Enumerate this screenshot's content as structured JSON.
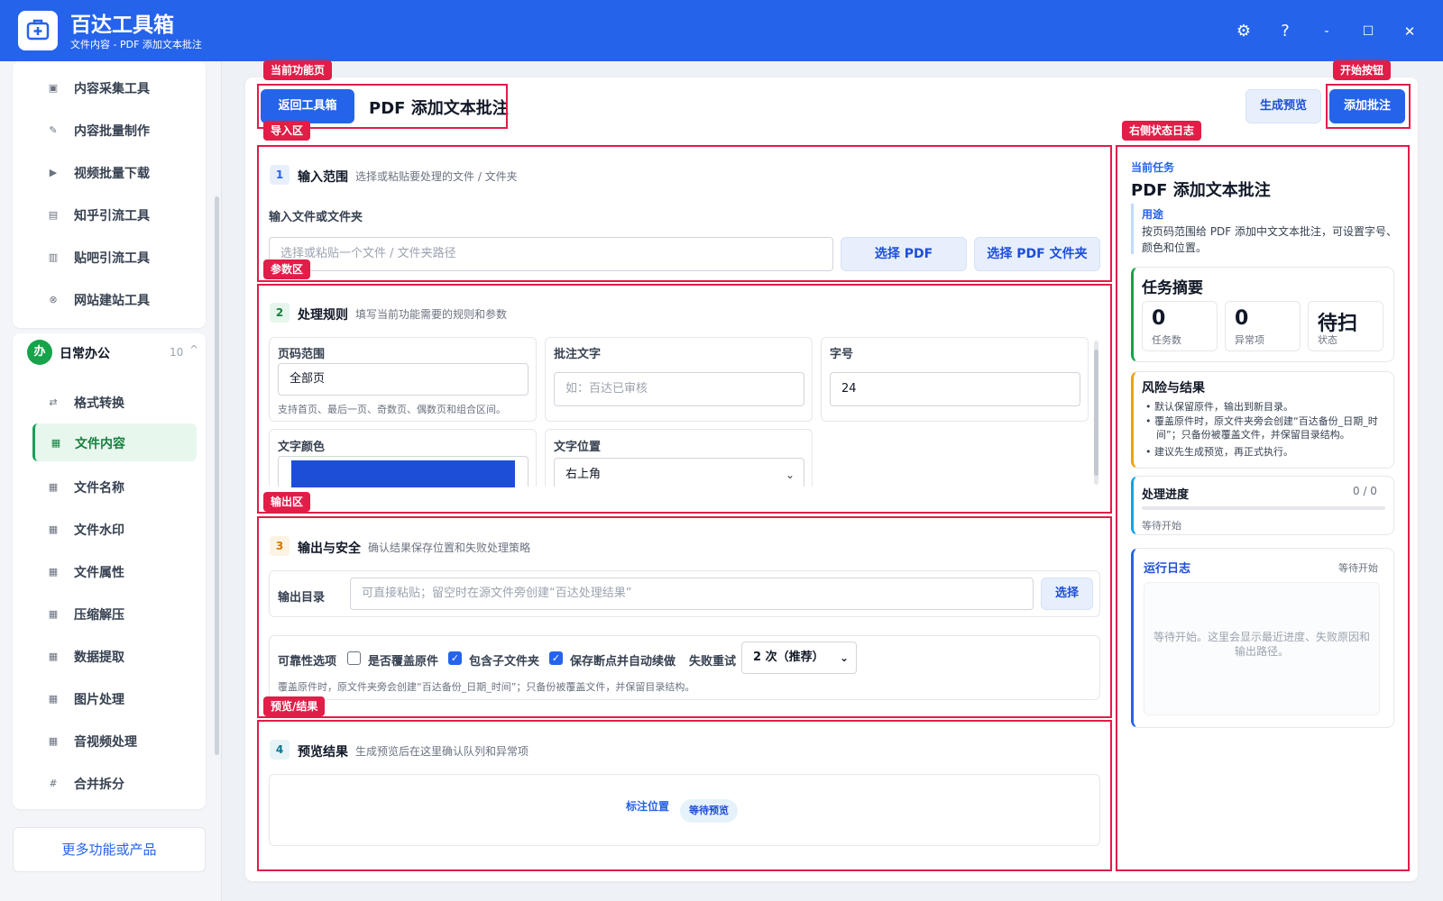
{
  "app": {
    "title": "百达工具箱",
    "subtitle": "文件内容 - PDF 添加文本批注",
    "window_controls": [
      "gear-icon",
      "help-icon",
      "minimize-icon",
      "maximize-icon",
      "close-icon"
    ],
    "window_glyphs": {
      "settings": "⚙",
      "help": "?",
      "minimize": "-",
      "maximize": "☐",
      "close": "✕"
    }
  },
  "sidebar": {
    "top_items": [
      {
        "label": "内容采集工具",
        "icon": "collect-icon"
      },
      {
        "label": "内容批量制作",
        "icon": "edit-icon"
      },
      {
        "label": "视频批量下载",
        "icon": "video-icon"
      },
      {
        "label": "知乎引流工具",
        "icon": "zhihu-icon"
      },
      {
        "label": "贴吧引流工具",
        "icon": "tieba-icon"
      },
      {
        "label": "网站建站工具",
        "icon": "website-icon"
      }
    ],
    "group": {
      "icon_text": "办",
      "label": "日常办公",
      "count": "10",
      "caret": "^"
    },
    "group_items": [
      {
        "label": "格式转换",
        "icon": "convert-icon"
      },
      {
        "label": "文件内容",
        "icon": "grid-icon"
      },
      {
        "label": "文件名称",
        "icon": "grid-icon"
      },
      {
        "label": "文件水印",
        "icon": "grid-icon"
      },
      {
        "label": "文件属性",
        "icon": "grid-icon"
      },
      {
        "label": "压缩解压",
        "icon": "grid-icon"
      },
      {
        "label": "数据提取",
        "icon": "grid-icon"
      },
      {
        "label": "图片处理",
        "icon": "grid-icon"
      },
      {
        "label": "音视频处理",
        "icon": "grid-icon"
      },
      {
        "label": "合并拆分",
        "icon": "hash-icon"
      }
    ],
    "active_item": "文件内容",
    "more_button": "更多功能或产品"
  },
  "tags": {
    "current_page": "当前功能页",
    "start_button": "开始按钮",
    "import_area": "导入区",
    "right_log": "右侧状态日志",
    "params_area": "参数区",
    "output_area": "输出区",
    "preview_result": "预览/结果"
  },
  "header": {
    "back_button": "返回工具箱",
    "page_title": "PDF 添加文本批注",
    "preview_button": "生成预览",
    "start_button": "添加批注"
  },
  "section1": {
    "num": "1",
    "title": "输入范围",
    "desc": "选择或粘贴要处理的文件 / 文件夹",
    "field_label": "输入文件或文件夹",
    "input_placeholder": "选择或粘贴一个文件 / 文件夹路径",
    "btn_pdf": "选择 PDF",
    "btn_folder": "选择 PDF 文件夹"
  },
  "section2": {
    "num": "2",
    "title": "处理规则",
    "desc": "填写当前功能需要的规则和参数",
    "page_range": {
      "label": "页码范围",
      "value": "全部页",
      "hint": "支持首页、最后一页、奇数页、偶数页和组合区间。"
    },
    "note_text": {
      "label": "批注文字",
      "placeholder": "如：百达已审核"
    },
    "font_size": {
      "label": "字号",
      "value": "24"
    },
    "text_color": {
      "label": "文字颜色",
      "value": "#1d4ed8"
    },
    "text_position": {
      "label": "文字位置",
      "value": "右上角"
    }
  },
  "section3": {
    "num": "3",
    "title": "输出与安全",
    "desc": "确认结果保存位置和失败处理策略",
    "output_label": "输出目录",
    "output_placeholder": "可直接粘贴；留空时在源文件旁创建“百达处理结果”",
    "choose_button": "选择",
    "reliability_label": "可靠性选项",
    "overwrite": {
      "label": "是否覆盖原件",
      "checked": false
    },
    "subfolders": {
      "label": "包含子文件夹",
      "checked": true
    },
    "resume": {
      "label": "保存断点并自动续做",
      "checked": true
    },
    "retry_label": "失败重试",
    "retry_value": "2 次（推荐）",
    "note": "覆盖原件时，原文件夹旁会创建“百达备份_日期_时间”；只备份被覆盖文件，并保留目录结构。"
  },
  "section4": {
    "num": "4",
    "title": "预览结果",
    "desc": "生成预览后在这里确认队列和异常项",
    "mark_label": "标注位置",
    "status_badge": "等待预览"
  },
  "right_panel": {
    "current_task_label": "当前任务",
    "current_task_title": "PDF 添加文本批注",
    "usage_label": "用途",
    "usage_text": "按页码范围给 PDF 添加中文文本批注，可设置字号、颜色和位置。",
    "summary_title": "任务摘要",
    "stats": [
      {
        "value": "0",
        "label": "任务数"
      },
      {
        "value": "0",
        "label": "异常项"
      },
      {
        "value": "待扫",
        "label": "状态"
      }
    ],
    "risk_title": "风险与结果",
    "risk_items": [
      "默认保留原件，输出到新目录。",
      "覆盖原件时，原文件夹旁会创建“百达备份_日期_时间”；只备份被覆盖文件，并保留目录结构。",
      "建议先生成预览，再正式执行。"
    ],
    "progress_title": "处理进度",
    "progress_value": "0 / 0",
    "progress_fraction": 0,
    "progress_status": "等待开始",
    "log_title": "运行日志",
    "log_status": "等待开始",
    "log_placeholder": "等待开始。这里会显示最近进度、失败原因和输出路径。"
  },
  "colors": {
    "brand": "#2563eb",
    "active_green": "#16a34a",
    "annotation_red": "#e11d48",
    "text_color_swatch": "#1d4ed8"
  }
}
